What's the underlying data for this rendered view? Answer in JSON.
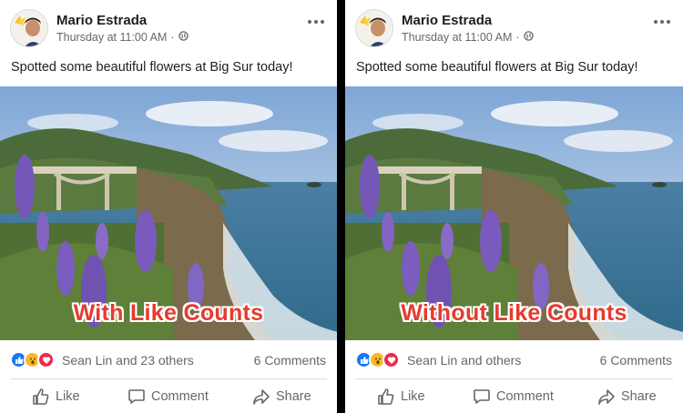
{
  "posts": [
    {
      "author": "Mario Estrada",
      "timestamp": "Thursday at 11:00 AM",
      "separator": "·",
      "caption": "Spotted some beautiful flowers at Big Sur today!",
      "overlay": "With Like Counts",
      "reactions_text": "Sean Lin and 23 others",
      "comments": "6 Comments",
      "actions": {
        "like": "Like",
        "comment": "Comment",
        "share": "Share"
      }
    },
    {
      "author": "Mario Estrada",
      "timestamp": "Thursday at 11:00 AM",
      "separator": "·",
      "caption": "Spotted some beautiful flowers at Big Sur today!",
      "overlay": "Without Like Counts",
      "reactions_text": "Sean Lin and others",
      "comments": "6 Comments",
      "actions": {
        "like": "Like",
        "comment": "Comment",
        "share": "Share"
      }
    }
  ],
  "icons": {
    "privacy": "globe-icon",
    "more": "more-options-icon",
    "reactions": [
      "like-reaction-icon",
      "wow-reaction-icon",
      "love-reaction-icon"
    ]
  },
  "colors": {
    "overlay_text": "#e53b2f",
    "like_blue": "#1877f2",
    "love_red": "#f02849",
    "wow_yellow": "#f7b928"
  }
}
